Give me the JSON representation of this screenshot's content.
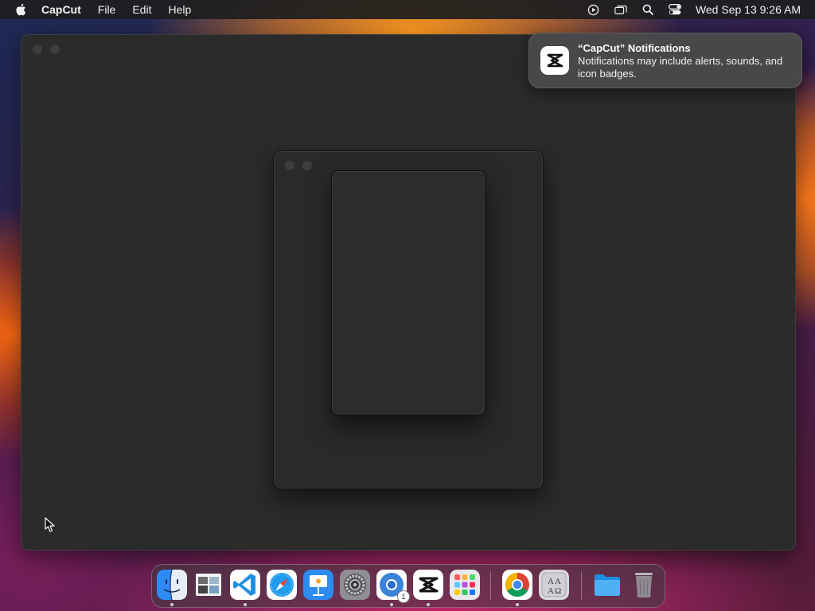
{
  "menubar": {
    "app_name": "CapCut",
    "menus": [
      "File",
      "Edit",
      "Help"
    ],
    "status_icons": [
      "screen-recording-icon",
      "screen-mirroring-icon",
      "spotlight-search-icon",
      "control-center-icon"
    ],
    "clock": "Wed Sep 13  9:26 AM"
  },
  "notification": {
    "title": "“CapCut” Notifications",
    "body": "Notifications may include alerts, sounds, and icon badges.",
    "app_icon": "capcut-icon"
  },
  "dock": {
    "items": [
      {
        "name": "Finder",
        "icon": "finder-icon",
        "running": true
      },
      {
        "name": "Preview",
        "icon": "preview-icon",
        "running": false
      },
      {
        "name": "Visual Studio Code",
        "icon": "vscode-icon",
        "running": true
      },
      {
        "name": "Safari",
        "icon": "safari-icon",
        "running": false
      },
      {
        "name": "Keynote",
        "icon": "keynote-icon",
        "running": false
      },
      {
        "name": "System Settings",
        "icon": "system-settings-icon",
        "running": false
      },
      {
        "name": "Chromium",
        "icon": "chromium-icon",
        "running": true,
        "badge": "1"
      },
      {
        "name": "CapCut",
        "icon": "capcut-icon",
        "running": true
      },
      {
        "name": "Launchpad",
        "icon": "launchpad-icon",
        "running": false
      },
      {
        "name": "Google Chrome",
        "icon": "chrome-icon",
        "running": true
      },
      {
        "name": "Dictionary",
        "icon": "dictionary-icon",
        "running": false
      },
      {
        "name": "Downloads",
        "icon": "folder-icon",
        "running": false
      },
      {
        "name": "Trash",
        "icon": "trash-icon",
        "running": false
      }
    ]
  },
  "colors": {
    "window_bg": "#2b2b2b",
    "notification_bg": "#4a4a4c",
    "menubar_bg": "#1e1e20"
  }
}
